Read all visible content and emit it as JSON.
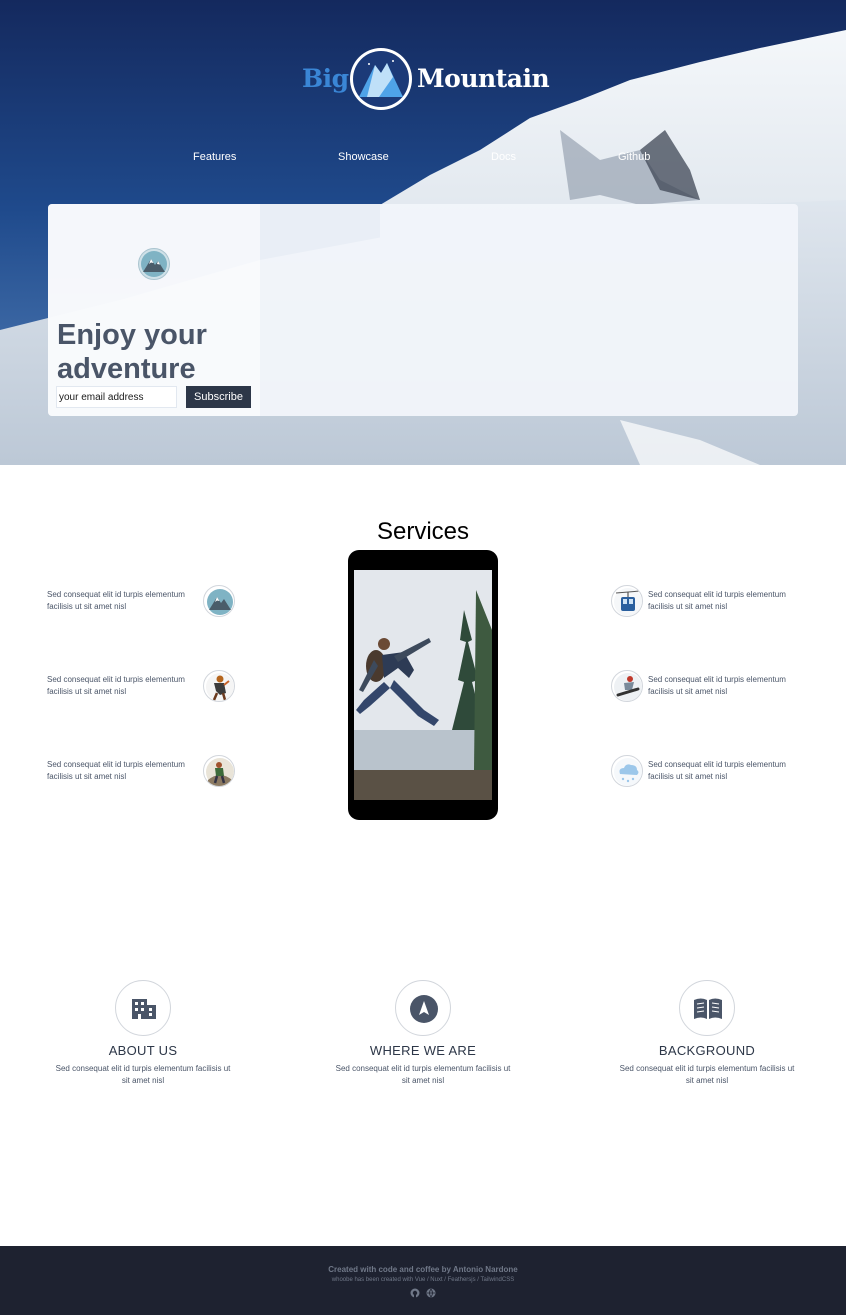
{
  "brand": {
    "part1": "Big",
    "part2": "Mountain"
  },
  "nav": [
    {
      "label": "Features"
    },
    {
      "label": "Showcase"
    },
    {
      "label": "Docs"
    },
    {
      "label": "Github"
    }
  ],
  "hero": {
    "title": "Enjoy your adventure",
    "email_placeholder": "your email address",
    "subscribe_label": "Subscribe"
  },
  "services": {
    "title": "Services",
    "items": [
      {
        "text": "Sed consequat elit id turpis elementum facilisis ut sit amet nisl",
        "icon": "mountain-icon"
      },
      {
        "text": "Sed consequat elit id turpis elementum facilisis ut sit amet nisl",
        "icon": "climber-icon"
      },
      {
        "text": "Sed consequat elit id turpis elementum facilisis ut sit amet nisl",
        "icon": "hiker-icon"
      },
      {
        "text": "Sed consequat elit id turpis elementum facilisis ut sit amet nisl",
        "icon": "cable-car-icon"
      },
      {
        "text": "Sed consequat elit id turpis elementum facilisis ut sit amet nisl",
        "icon": "snowboarder-icon"
      },
      {
        "text": "Sed consequat elit id turpis elementum facilisis ut sit amet nisl",
        "icon": "snow-cloud-icon"
      }
    ]
  },
  "features": [
    {
      "title": "ABOUT US",
      "text": "Sed consequat elit id turpis elementum facilisis ut sit amet nisl",
      "icon": "building-icon"
    },
    {
      "title": "WHERE WE ARE",
      "text": "Sed consequat elit id turpis elementum facilisis ut sit amet nisl",
      "icon": "location-arrow-icon"
    },
    {
      "title": "BACKGROUND",
      "text": "Sed consequat elit id turpis elementum facilisis ut sit amet nisl",
      "icon": "book-icon"
    }
  ],
  "footer": {
    "credit": "Created with code and coffee by Antonio Nardone",
    "tech": "whoobe has been created with Vue / Nuxt / Feathersjs / TailwindCSS",
    "icons": [
      "github-icon",
      "globe-icon"
    ]
  },
  "colors": {
    "footer_bg": "#1e2230",
    "button_bg": "#2d3748",
    "brand_blue": "#3a86d6",
    "heading_gray": "#4a5568"
  }
}
